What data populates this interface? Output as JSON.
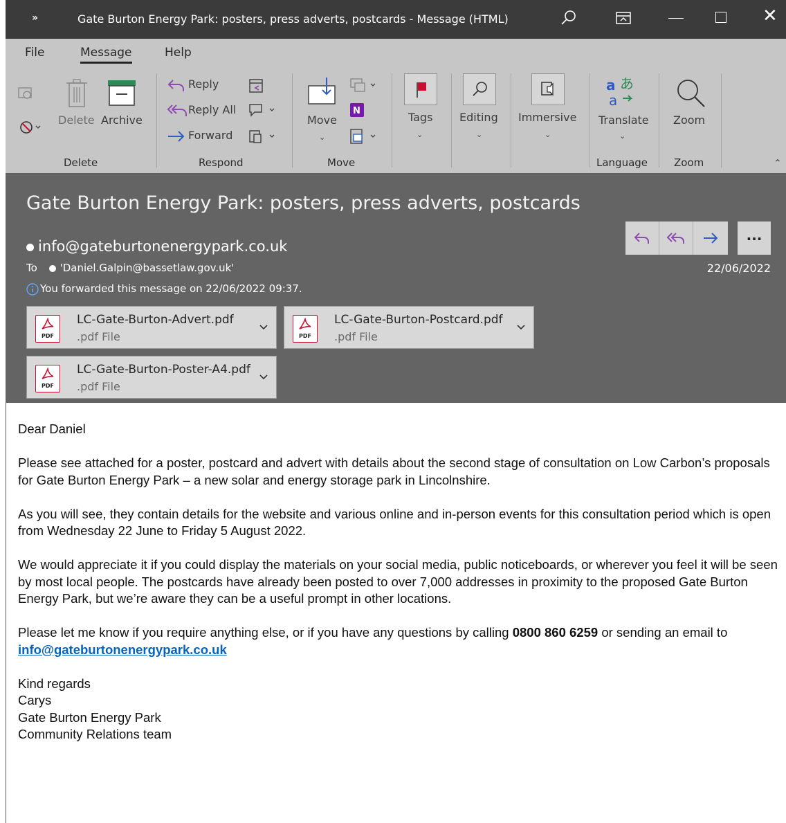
{
  "window": {
    "title": "Gate Burton Energy Park: posters, press adverts, postcards   -  Message (HTML)",
    "expand_label": "»"
  },
  "ribbon": {
    "tabs": [
      "File",
      "Message",
      "Help"
    ],
    "active_tab": "Message",
    "delete_group": {
      "delete_label": "Delete",
      "archive_label": "Archive",
      "group_label": "Delete"
    },
    "respond_group": {
      "reply_label": "Reply",
      "reply_all_label": "Reply All",
      "forward_label": "Forward",
      "group_label": "Respond"
    },
    "move_group": {
      "move_label": "Move",
      "group_label": "Move"
    },
    "tags_label": "Tags",
    "editing_label": "Editing",
    "immersive_label": "Immersive",
    "translate_label": "Translate",
    "zoom_label": "Zoom",
    "language_group_label": "Language",
    "zoom_group_label": "Zoom"
  },
  "header": {
    "subject": "Gate Burton Energy Park: posters, press adverts, postcards",
    "from": "info@gateburtonenergypark.co.uk",
    "to_label": "To",
    "to": "'Daniel.Galpin@bassetlaw.gov.uk'",
    "info": "You forwarded this message on 22/06/2022 09:37.",
    "date": "22/06/2022",
    "more_label": "..."
  },
  "attachments": [
    {
      "name": "LC-Gate-Burton-Advert.pdf",
      "type": ".pdf File",
      "icon_label": "PDF"
    },
    {
      "name": "LC-Gate-Burton-Postcard.pdf",
      "type": ".pdf File",
      "icon_label": "PDF"
    },
    {
      "name": "LC-Gate-Burton-Poster-A4.pdf",
      "type": ".pdf File",
      "icon_label": "PDF"
    }
  ],
  "body": {
    "greeting": "Dear Daniel",
    "p1": "Please see attached for a poster, postcard and advert with details about the second stage of consultation on Low Carbon’s proposals for Gate Burton Energy Park – a new solar and energy storage park in Lincolnshire.",
    "p2": "As you will see, they contain details for the website and various online and in-person events for this consultation period which is open from Wednesday 22 June to Friday 5 August 2022.",
    "p3": "We would appreciate it if you could display the materials on your social media, public noticeboards, or wherever you feel it will be seen by most local people. The postcards have already been posted to over 7,000 addresses in proximity to the proposed Gate Burton Energy Park, but we’re aware they can be a useful prompt in other locations.",
    "p4_pre": "Please let me know if you require anything else, or if you have any questions by calling ",
    "phone": "0800 860 6259",
    "p4_mid": " or sending an email to ",
    "email_link": "info@gateburtonenergypark.co.uk",
    "sign_off": "Kind regards",
    "sig_name": "Carys",
    "sig_org": "Gate Burton Energy Park",
    "sig_team": "Community Relations team"
  },
  "colors": {
    "titlebar": "#3b3b3b",
    "ribbon": "#c6c6c6",
    "header": "#646464",
    "accent": "#2f5cc4",
    "link": "#0563c1",
    "pdf_red": "#c8102e"
  }
}
